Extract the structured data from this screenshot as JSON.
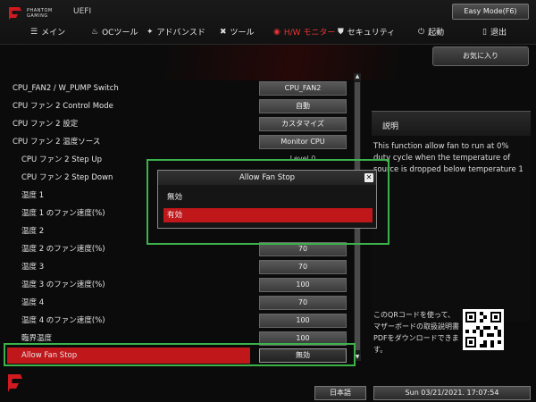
{
  "header": {
    "brand_line1": "PHANTOM",
    "brand_line2": "GAMING",
    "uefi_label": "UEFI",
    "easy_mode_label": "Easy Mode(F6)"
  },
  "nav": {
    "items": [
      {
        "label": "メイン",
        "icon": "menu-icon"
      },
      {
        "label": "OCツール",
        "icon": "flame-icon"
      },
      {
        "label": "アドバンスド",
        "icon": "star-icon"
      },
      {
        "label": "ツール",
        "icon": "tools-icon"
      },
      {
        "label": "H/W モニター",
        "icon": "monitor-icon",
        "active": true
      },
      {
        "label": "セキュリティ",
        "icon": "shield-icon"
      },
      {
        "label": "起動",
        "icon": "power-icon"
      },
      {
        "label": "退出",
        "icon": "exit-icon"
      }
    ],
    "active_color": "#e33333"
  },
  "favorites_label": "お気に入り",
  "settings": [
    {
      "label": "CPU_FAN2 / W_PUMP Switch",
      "value": "CPU_FAN2",
      "indent": false
    },
    {
      "label": "CPU ファン 2 Control Mode",
      "value": "自動",
      "indent": false
    },
    {
      "label": "CPU ファン 2 設定",
      "value": "カスタマイズ",
      "indent": false
    },
    {
      "label": "CPU ファン 2 温度ソース",
      "value": "Monitor CPU",
      "indent": false
    },
    {
      "label": "CPU ファン 2 Step Up",
      "value": "Level 0",
      "indent": true
    },
    {
      "label": "CPU ファン 2 Step Down",
      "value": "",
      "indent": true
    },
    {
      "label": "温度 1",
      "value": "",
      "indent": true
    },
    {
      "label": "温度 1 のファン速度(%)",
      "value": "",
      "indent": true
    },
    {
      "label": "温度 2",
      "value": "",
      "indent": true
    },
    {
      "label": "温度 2 のファン速度(%)",
      "value": "70",
      "indent": true
    },
    {
      "label": "温度 3",
      "value": "70",
      "indent": true
    },
    {
      "label": "温度 3 のファン速度(%)",
      "value": "100",
      "indent": true
    },
    {
      "label": "温度 4",
      "value": "70",
      "indent": true
    },
    {
      "label": "温度 4 のファン速度(%)",
      "value": "100",
      "indent": true
    },
    {
      "label": "臨界温度",
      "value": "100",
      "indent": true
    },
    {
      "label": "Allow Fan Stop",
      "value": "無効",
      "indent": true,
      "selected": true
    }
  ],
  "description": {
    "title": "説明",
    "text": "This function allow fan to run at 0% duty cycle when the temperature of source is dropped below temperature 1",
    "qr_text": "このQRコードを使って、マザーボードの取扱説明書PDFをダウンロードできます。"
  },
  "modal": {
    "title": "Allow Fan Stop",
    "options": [
      "無効",
      "有効"
    ],
    "selected_index": 1
  },
  "footer": {
    "language": "日本語",
    "datetime": "Sun 03/21/2021. 17:07:54"
  },
  "colors": {
    "accent_red": "#c0171b",
    "highlight_green": "#3cb24a"
  }
}
